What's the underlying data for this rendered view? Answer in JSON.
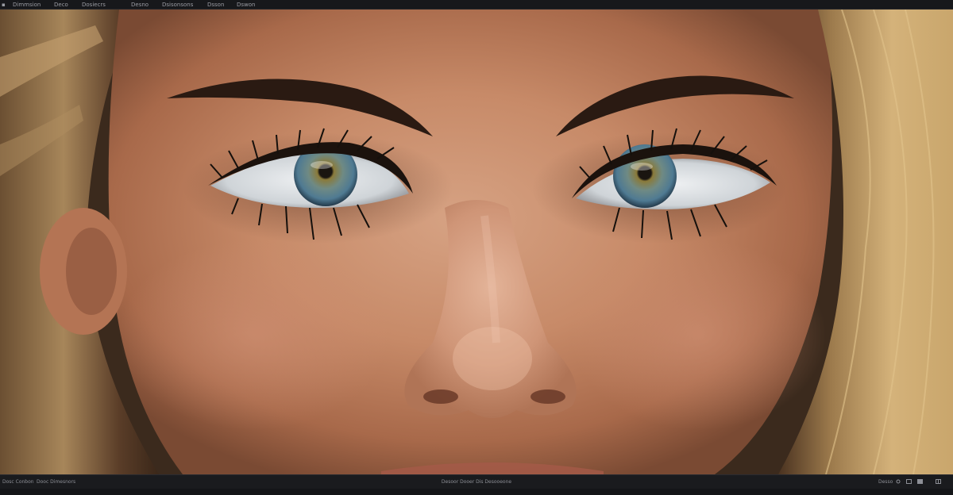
{
  "menu": {
    "items": [
      {
        "label": "Dimmsion"
      },
      {
        "label": "Deco"
      },
      {
        "label": "Dosiecrs"
      },
      {
        "label": "Desno"
      },
      {
        "label": "Dsisonsons"
      },
      {
        "label": "Dsson"
      },
      {
        "label": "Dswon"
      }
    ]
  },
  "status": {
    "left_1": "Dosc Conbon",
    "left_2": "Dooc Dimesnors",
    "center": "Desoor Dooer Dis Desooeone",
    "right_value": "Desso",
    "icons": [
      "zoom-icon",
      "grid-icon",
      "panel-icon",
      "settings-icon"
    ]
  },
  "colors": {
    "menubar": "#17181b",
    "statusbar": "#1a1b1e",
    "menu_text": "#9a9ca3",
    "skin": "#c88e6c",
    "hair": "#b8935e",
    "iris": "#5f7f8a"
  }
}
